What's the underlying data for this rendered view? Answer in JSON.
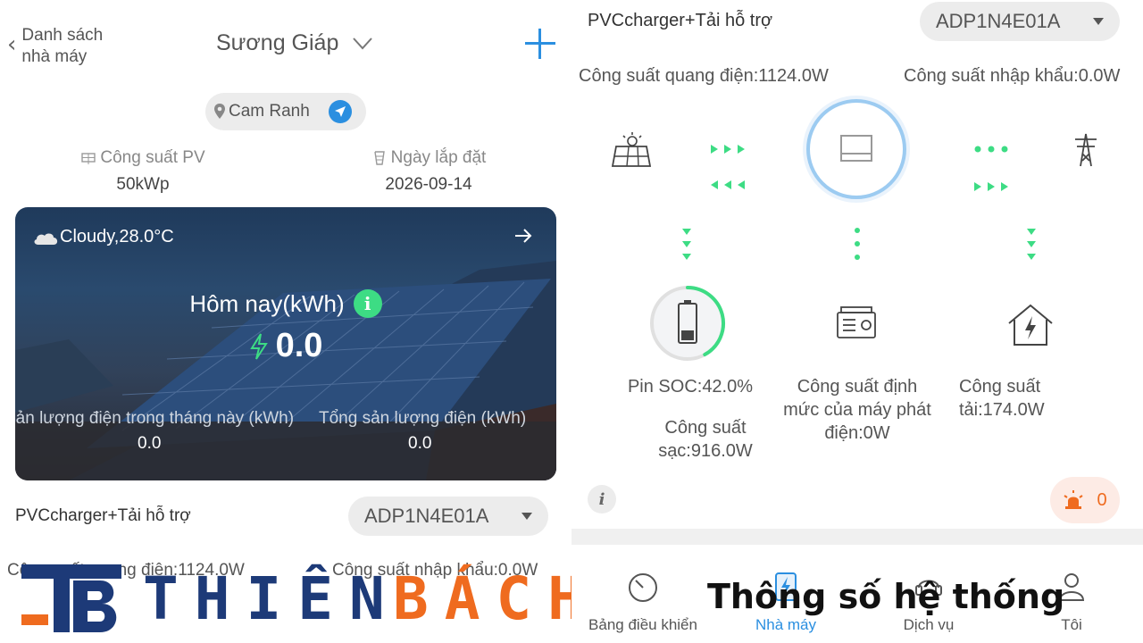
{
  "left": {
    "back_label": "Danh sách nhà máy",
    "plant_name": "Sương Giáp",
    "location": "Cam Ranh",
    "pv_capacity_label": "Công suất PV",
    "pv_capacity_value": "50kWp",
    "install_date_label": "Ngày lắp đặt",
    "install_date_value": "2026-09-14",
    "weather": "Cloudy,28.0°C",
    "today_label": "Hôm nay(kWh)",
    "today_value": "0.0",
    "month_label": "Sản lượng điện trong tháng này (kWh)",
    "month_value": "0.0",
    "total_label": "Tổng sản lượng điện (kWh)",
    "total_value": "0.0",
    "device_title": "PVCcharger+Tải hỗ trợ",
    "device_id": "ADP1N4E01A",
    "pv_power": "Công suất quang điện:1124.0W",
    "import_power": "Công suất nhập khẩu:0.0W"
  },
  "brand": {
    "name_part1": "THIÊN",
    "name_part2": "BÁCH",
    "logo_letters": "TB"
  },
  "right": {
    "device_title": "PVCcharger+Tải hỗ trợ",
    "device_id": "ADP1N4E01A",
    "pv_power": "Công suất quang điện:1124.0W",
    "import_power": "Công suất nhập khẩu:0.0W",
    "battery_soc_label": "Pin SOC:42.0%",
    "battery_soc_percent": 42,
    "charge_power_line1": "Công suất",
    "charge_power_line2": "sạc:916.0W",
    "generator_line1": "Công suất định",
    "generator_line2": "mức của máy phát",
    "generator_line3": "điện:0W",
    "load_line1": "Công suất",
    "load_line2": "tải:174.0W",
    "alarm_count": "0",
    "info_symbol": "i"
  },
  "tabs": [
    {
      "label": "Bảng điều khiển",
      "icon": "gauge-icon"
    },
    {
      "label": "Nhà máy",
      "icon": "plant-icon"
    },
    {
      "label": "Dịch vụ",
      "icon": "service-icon"
    },
    {
      "label": "Tôi",
      "icon": "user-icon"
    }
  ],
  "caption": "Thông số hệ thống",
  "colors": {
    "accent_blue": "#2b8fe0",
    "flow_green": "#3ddc84",
    "alarm_orange": "#ef6b1f",
    "brand_navy": "#1d3a78"
  }
}
